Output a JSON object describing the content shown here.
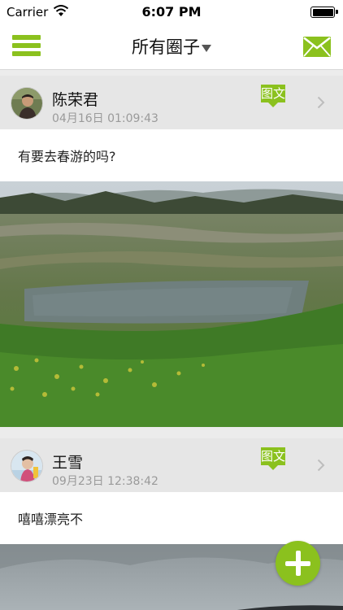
{
  "status_bar": {
    "carrier": "Carrier",
    "time": "6:07 PM",
    "battery_level": 1.0
  },
  "nav": {
    "title": "所有圈子"
  },
  "posts": [
    {
      "author": "陈荣君",
      "time": "04月16日 01:09:43",
      "tag": "图文",
      "text": "有要去春游的吗?"
    },
    {
      "author": "王雪",
      "time": "09月23日 12:38:42",
      "tag": "图文",
      "text": "嘻嘻漂亮不"
    }
  ],
  "colors": {
    "accent": "#8bc11e",
    "header_bg": "#e6e6e6",
    "time_text": "#9a9a9a"
  }
}
